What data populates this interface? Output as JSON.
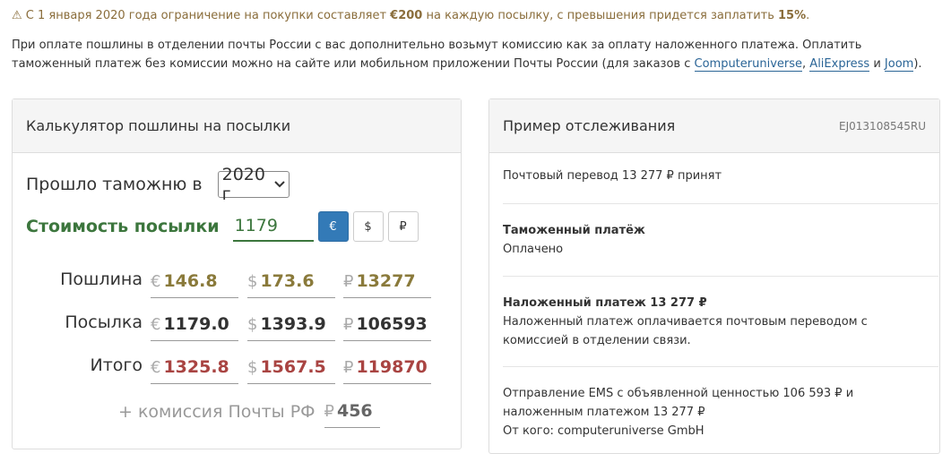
{
  "notice": {
    "icon": "warning-icon",
    "prefix": "⚠ С 1 января 2020 года ограничение на покупки составляет ",
    "limit": "€200",
    "middle": " на каждую посылку, с превышения придется заплатить ",
    "rate": "15%",
    "suffix": "."
  },
  "info": {
    "text": "При оплате пошлины в отделении почты России с вас дополнительно возьмут комиссию как за оплату наложенного платежа. Оплатить таможенный платеж без комиссии можно на сайте или мобильном приложении Почты России (для заказов с ",
    "link1": "Computeruniverse",
    "sep1": ", ",
    "link2": "AliExpress",
    "sep2": " и ",
    "link3": "Joom",
    "end": ")."
  },
  "calculator": {
    "title": "Калькулятор пошлины на посылки",
    "customs_label": "Прошло таможню в",
    "year_value": "2020 г",
    "cost_label": "Стоимость посылки",
    "cost_value": "1179",
    "currency_buttons": [
      "€",
      "$",
      "₽"
    ],
    "active_currency": "€",
    "rows": [
      {
        "label": "Пошлина",
        "eur": "146.8",
        "usd": "173.6",
        "rub": "13277"
      },
      {
        "label": "Посылка",
        "eur": "1179.0",
        "usd": "1393.9",
        "rub": "106593"
      },
      {
        "label": "Итого",
        "eur": "1325.8",
        "usd": "1567.5",
        "rub": "119870"
      }
    ],
    "symbols": {
      "eur": "€",
      "usd": "$",
      "rub": "₽"
    },
    "commission_label": "+ комиссия Почты РФ",
    "commission_value": "456"
  },
  "tracking": {
    "title": "Пример отслеживания",
    "track_id": "EJ013108545RU",
    "events": [
      {
        "title": "",
        "text": "Почтовый перевод 13 277 ₽ принят"
      },
      {
        "title": "Таможенный платёж",
        "text": "Оплачено"
      },
      {
        "title": "Наложенный платеж 13 277 ₽",
        "text": "Наложенный платеж оплачивается почтовым переводом с комиссией в отделении связи."
      },
      {
        "title": "",
        "text": "Отправление EMS с объявленной ценностью 106 593 ₽ и наложенным платежом 13 277 ₽",
        "text2": "От кого: computeruniverse GmbH"
      }
    ]
  }
}
